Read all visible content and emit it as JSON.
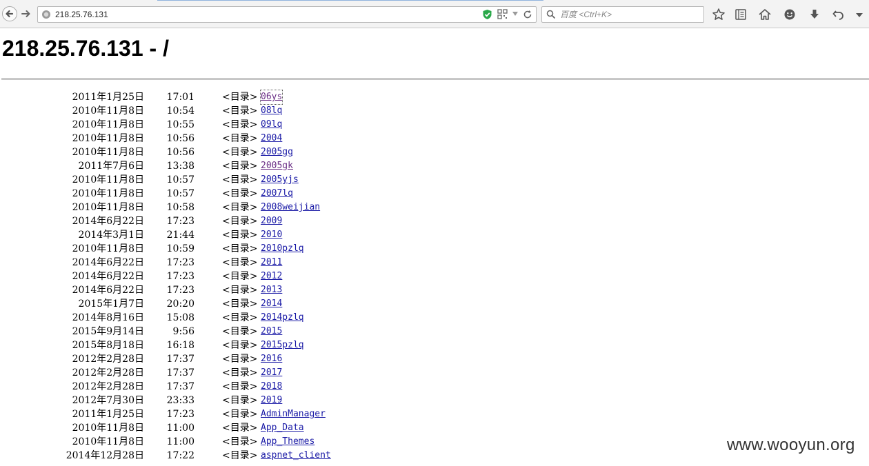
{
  "browser": {
    "url": "218.25.76.131",
    "search_placeholder": "百度 <Ctrl+K>"
  },
  "page": {
    "title": "218.25.76.131 - /",
    "entries": [
      {
        "date": "2011年1月25日",
        "time": "17:01",
        "type": "<目录>",
        "name": "06ys"
      },
      {
        "date": "2010年11月8日",
        "time": "10:54",
        "type": "<目录>",
        "name": "08lq"
      },
      {
        "date": "2010年11月8日",
        "time": "10:55",
        "type": "<目录>",
        "name": "09lq"
      },
      {
        "date": "2010年11月8日",
        "time": "10:56",
        "type": "<目录>",
        "name": "2004"
      },
      {
        "date": "2010年11月8日",
        "time": "10:56",
        "type": "<目录>",
        "name": "2005gg"
      },
      {
        "date": "2011年7月6日",
        "time": "13:38",
        "type": "<目录>",
        "name": "2005gk"
      },
      {
        "date": "2010年11月8日",
        "time": "10:57",
        "type": "<目录>",
        "name": "2005yjs"
      },
      {
        "date": "2010年11月8日",
        "time": "10:57",
        "type": "<目录>",
        "name": "2007lq"
      },
      {
        "date": "2010年11月8日",
        "time": "10:58",
        "type": "<目录>",
        "name": "2008weijian"
      },
      {
        "date": "2014年6月22日",
        "time": "17:23",
        "type": "<目录>",
        "name": "2009"
      },
      {
        "date": "2014年3月1日",
        "time": "21:44",
        "type": "<目录>",
        "name": "2010"
      },
      {
        "date": "2010年11月8日",
        "time": "10:59",
        "type": "<目录>",
        "name": "2010pzlq"
      },
      {
        "date": "2014年6月22日",
        "time": "17:23",
        "type": "<目录>",
        "name": "2011"
      },
      {
        "date": "2014年6月22日",
        "time": "17:23",
        "type": "<目录>",
        "name": "2012"
      },
      {
        "date": "2014年6月22日",
        "time": "17:23",
        "type": "<目录>",
        "name": "2013"
      },
      {
        "date": "2015年1月7日",
        "time": "20:20",
        "type": "<目录>",
        "name": "2014"
      },
      {
        "date": "2014年8月16日",
        "time": "15:08",
        "type": "<目录>",
        "name": "2014pzlq"
      },
      {
        "date": "2015年9月14日",
        "time": "9:56",
        "type": "<目录>",
        "name": "2015"
      },
      {
        "date": "2015年8月18日",
        "time": "16:18",
        "type": "<目录>",
        "name": "2015pzlq"
      },
      {
        "date": "2012年2月28日",
        "time": "17:37",
        "type": "<目录>",
        "name": "2016"
      },
      {
        "date": "2012年2月28日",
        "time": "17:37",
        "type": "<目录>",
        "name": "2017"
      },
      {
        "date": "2012年2月28日",
        "time": "17:37",
        "type": "<目录>",
        "name": "2018"
      },
      {
        "date": "2012年7月30日",
        "time": "23:33",
        "type": "<目录>",
        "name": "2019"
      },
      {
        "date": "2011年1月25日",
        "time": "17:23",
        "type": "<目录>",
        "name": "AdminManager"
      },
      {
        "date": "2010年11月8日",
        "time": "11:00",
        "type": "<目录>",
        "name": "App_Data"
      },
      {
        "date": "2010年11月8日",
        "time": "11:00",
        "type": "<目录>",
        "name": "App_Themes"
      },
      {
        "date": "2014年12月28日",
        "time": "17:22",
        "type": "<目录>",
        "name": "aspnet_client"
      }
    ]
  },
  "watermark": "www.wooyun.org"
}
